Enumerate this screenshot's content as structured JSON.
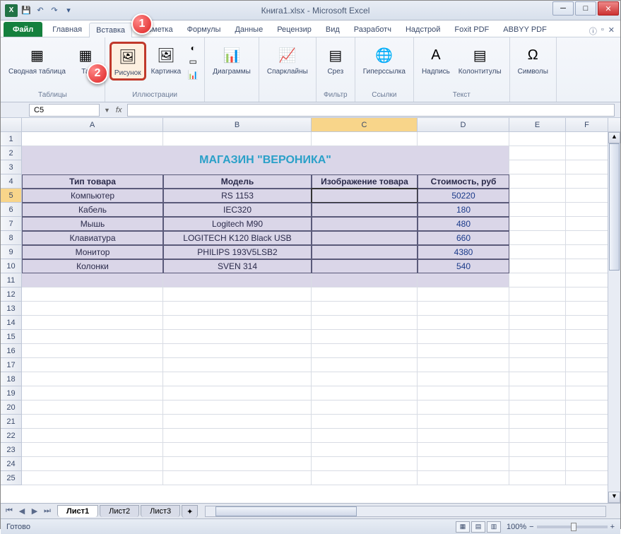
{
  "window": {
    "title": "Книга1.xlsx - Microsoft Excel"
  },
  "qat": {
    "save": "💾",
    "undo": "↶",
    "redo": "↷"
  },
  "tabs": {
    "file": "Файл",
    "items": [
      "Главная",
      "Вставка",
      "Разметка",
      "Формулы",
      "Данные",
      "Рецензир",
      "Вид",
      "Разработч",
      "Надстрой",
      "Foxit PDF",
      "ABBYY PDF"
    ],
    "active_index": 1
  },
  "ribbon": {
    "groups": [
      {
        "label": "Таблицы",
        "buttons": [
          {
            "label": "Сводная\nтаблица",
            "icon": "▦"
          },
          {
            "label": "Та",
            "icon": "▦"
          }
        ]
      },
      {
        "label": "Иллюстрации",
        "buttons": [
          {
            "label": "Рисунок",
            "icon": "🖼",
            "highlighted": true
          },
          {
            "label": "Картинка",
            "icon": "🖼"
          }
        ],
        "small": [
          "◐",
          "▭",
          "📊"
        ]
      },
      {
        "label": "",
        "buttons": [
          {
            "label": "Диаграммы",
            "icon": "📊"
          }
        ]
      },
      {
        "label": "",
        "buttons": [
          {
            "label": "Спарклайны",
            "icon": "📈"
          }
        ]
      },
      {
        "label": "Фильтр",
        "buttons": [
          {
            "label": "Срез",
            "icon": "▤"
          }
        ]
      },
      {
        "label": "Ссылки",
        "buttons": [
          {
            "label": "Гиперссылка",
            "icon": "🌐"
          }
        ]
      },
      {
        "label": "Текст",
        "buttons": [
          {
            "label": "Надпись",
            "icon": "A"
          },
          {
            "label": "Колонтитулы",
            "icon": "▤"
          }
        ]
      },
      {
        "label": "",
        "buttons": [
          {
            "label": "Символы",
            "icon": "Ω"
          }
        ]
      }
    ]
  },
  "badges": [
    "1",
    "2"
  ],
  "formula": {
    "namebox": "C5",
    "fx": "fx",
    "value": ""
  },
  "columns": [
    "A",
    "B",
    "C",
    "D",
    "E",
    "F"
  ],
  "selected_col": "C",
  "selected_row": 5,
  "store_title": "МАГАЗИН \"ВЕРОНИКА\"",
  "table": {
    "headers": [
      "Тип товара",
      "Модель",
      "Изображение товара",
      "Стоимость, руб"
    ],
    "rows": [
      [
        "Компьютер",
        "RS 1153",
        "",
        "50220"
      ],
      [
        "Кабель",
        "IEC320",
        "",
        "180"
      ],
      [
        "Мышь",
        "Logitech M90",
        "",
        "480"
      ],
      [
        "Клавиатура",
        "LOGITECH K120 Black USB",
        "",
        "660"
      ],
      [
        "Монитор",
        "PHILIPS 193V5LSB2",
        "",
        "4380"
      ],
      [
        "Колонки",
        "SVEN 314",
        "",
        "540"
      ]
    ]
  },
  "sheets": {
    "items": [
      "Лист1",
      "Лист2",
      "Лист3"
    ],
    "active": 0
  },
  "status": {
    "ready": "Готово",
    "zoom": "100%"
  }
}
